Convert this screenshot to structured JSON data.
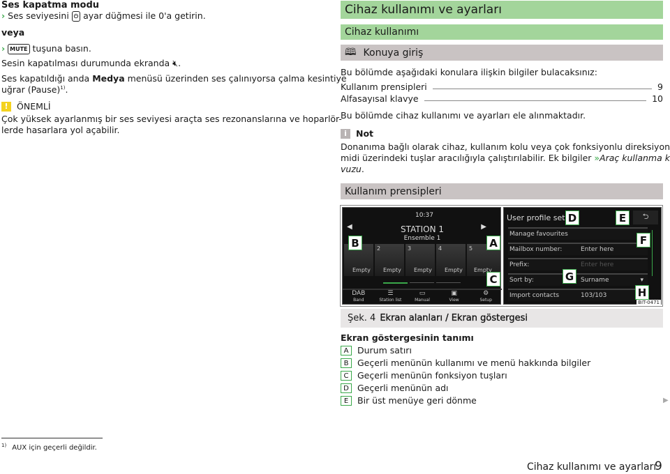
{
  "left": {
    "heading": "Ses kapatma modu",
    "step1_pre": "Ses seviyesini",
    "step1_icon": "power-knob-icon",
    "step1_post": "ayar düğmesi ile 0'a getirin.",
    "or": "veya",
    "step2_key": "MUTE",
    "step2_post": "tuşuna basın.",
    "mute_text": "Sesin kapatılması durumunda ekranda",
    "mute_icon": "speaker-muted-icon",
    "pause_pre": "Ses kapatıldığı anda",
    "pause_bold": "Medya",
    "pause_post": "menüsü üzerinden ses çalınıyorsa çalma kesintiye",
    "pause_line2": "uğrar (Pause)",
    "pause_sup": "1)",
    "warning_title": "ÖNEMLİ",
    "warning_line1": "Çok yüksek ayarlanmış bir ses seviyesi araçta ses rezonanslarına ve hoparlör-",
    "warning_line2": "lerde hasarlara yol açabilir."
  },
  "right": {
    "title": "Cihaz kullanımı ve ayarları",
    "subtitle": "Cihaz kullanımı",
    "intro_heading": "Konuya giriş",
    "intro_text": "Bu bölümde aşağıdaki konulara ilişkin bilgiler bulacaksınız:",
    "toc": [
      {
        "label": "Kullanım prensipleri",
        "page": "9"
      },
      {
        "label": "Alfasayısal klavye",
        "page": "10"
      }
    ],
    "summary": "Bu bölümde cihaz kullanımı ve ayarları ele alınmaktadır.",
    "note_title": "Not",
    "note_line1": "Donanıma bağlı olarak cihaz, kullanım kolu veya çok fonksiyonlu direksiyon si-",
    "note_line2_pre": "midi üzerindeki tuşlar aracılığıyla çalıştırılabilir. Ek bilgiler",
    "note_link_arrow": "»",
    "note_link": "Araç kullanma kıla-",
    "note_line3": "vuzu",
    "section": "Kullanım prensipleri",
    "figure": {
      "left_screen": {
        "time": "10:37",
        "station": "STATION 1",
        "ensemble": "Ensemble 1",
        "presets": [
          "",
          "2",
          "3",
          "4",
          "5"
        ],
        "preset_labels": [
          "Empty",
          "Empty",
          "Empty",
          "Empty",
          "Empty"
        ],
        "buttons": [
          {
            "top": "DAB",
            "bottom": "Band"
          },
          {
            "top": "☰",
            "bottom": "Station list"
          },
          {
            "top": "▭",
            "bottom": "Manual"
          },
          {
            "top": "▣",
            "bottom": "View"
          },
          {
            "top": "⚙",
            "bottom": "Setup"
          }
        ]
      },
      "right_screen": {
        "title": "User profile setup",
        "rows": [
          {
            "label": "Manage favourites",
            "value": ""
          },
          {
            "label": "Mailbox number:",
            "value": "Enter here"
          },
          {
            "label": "Prefix:",
            "value": "Enter here"
          },
          {
            "label": "Sort by:",
            "value": "Surname"
          },
          {
            "label": "Import contacts",
            "value": "103/103"
          }
        ]
      },
      "callouts": [
        "A",
        "B",
        "C",
        "D",
        "E",
        "F",
        "G",
        "H"
      ],
      "code": "BIT-0471"
    },
    "caption_num": "Şek. 4",
    "caption": "Ekran alanları / Ekran göstergesi",
    "legend_title": "Ekran göstergesinin tanımı",
    "legend": [
      {
        "key": "A",
        "text": "Durum satırı"
      },
      {
        "key": "B",
        "text": "Geçerli menünün kullanımı ve menü hakkında bilgiler"
      },
      {
        "key": "C",
        "text": "Geçerli menünün fonksiyon tuşları"
      },
      {
        "key": "D",
        "text": "Geçerli menünün adı"
      },
      {
        "key": "E",
        "text": "Bir üst menüye geri dönme"
      }
    ]
  },
  "footnote": {
    "mark": "1)",
    "text": "AUX için geçerli değildir."
  },
  "footer": {
    "title": "Cihaz kullanımı ve ayarları",
    "page": "9"
  },
  "colors": {
    "accent": "#3aa84a",
    "header_green": "#a3d59b",
    "header_gray": "#c9c3c3",
    "warning": "#f4d21f"
  }
}
